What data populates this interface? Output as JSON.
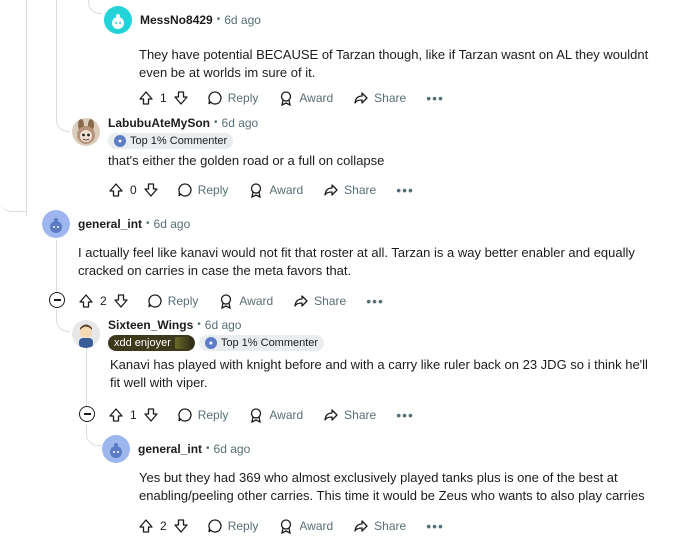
{
  "actions": {
    "reply": "Reply",
    "award": "Award",
    "share": "Share",
    "more": "•••"
  },
  "colors": {
    "text": "#1c1c1c",
    "meta": "#576f76",
    "thread_line": "#d9dde0",
    "flair_bg": "#eaedef"
  },
  "comments": [
    {
      "username": "MessNo8429",
      "time": "6d ago",
      "avatar": "snoo-cyan-avatar",
      "body": "They have potential BECAUSE of Tarzan though, like if Tarzan wasnt on AL they wouldnt even be at worlds im sure of it.",
      "votes": "1"
    },
    {
      "username": "LabubuAteMySon",
      "time": "6d ago",
      "avatar": "labubu-avatar",
      "flair": "Top 1% Commenter",
      "body": "that's either the golden road or a full on collapse",
      "votes": "0"
    },
    {
      "username": "general_int",
      "time": "6d ago",
      "avatar": "snoo-blue-avatar",
      "body": "I actually feel like kanavi would not fit that roster at all. Tarzan is a way better enabler and equally cracked on carries in case the meta favors that.",
      "votes": "2"
    },
    {
      "username": "Sixteen_Wings",
      "time": "6d ago",
      "avatar": "custom-avatar",
      "user_flair": "xdd enjoyer",
      "flair": "Top 1% Commenter",
      "body": "Kanavi has played with knight before and with a carry like ruler back on 23 JDG so i think he'll fit well with viper.",
      "votes": "1"
    },
    {
      "username": "general_int",
      "time": "6d ago",
      "avatar": "snoo-blue-avatar",
      "body": "Yes but they had 369 who almost exclusively played tanks plus is one of the best at enabling/peeling other carries. This time it would be Zeus who wants to also play carries",
      "votes": "2"
    }
  ]
}
